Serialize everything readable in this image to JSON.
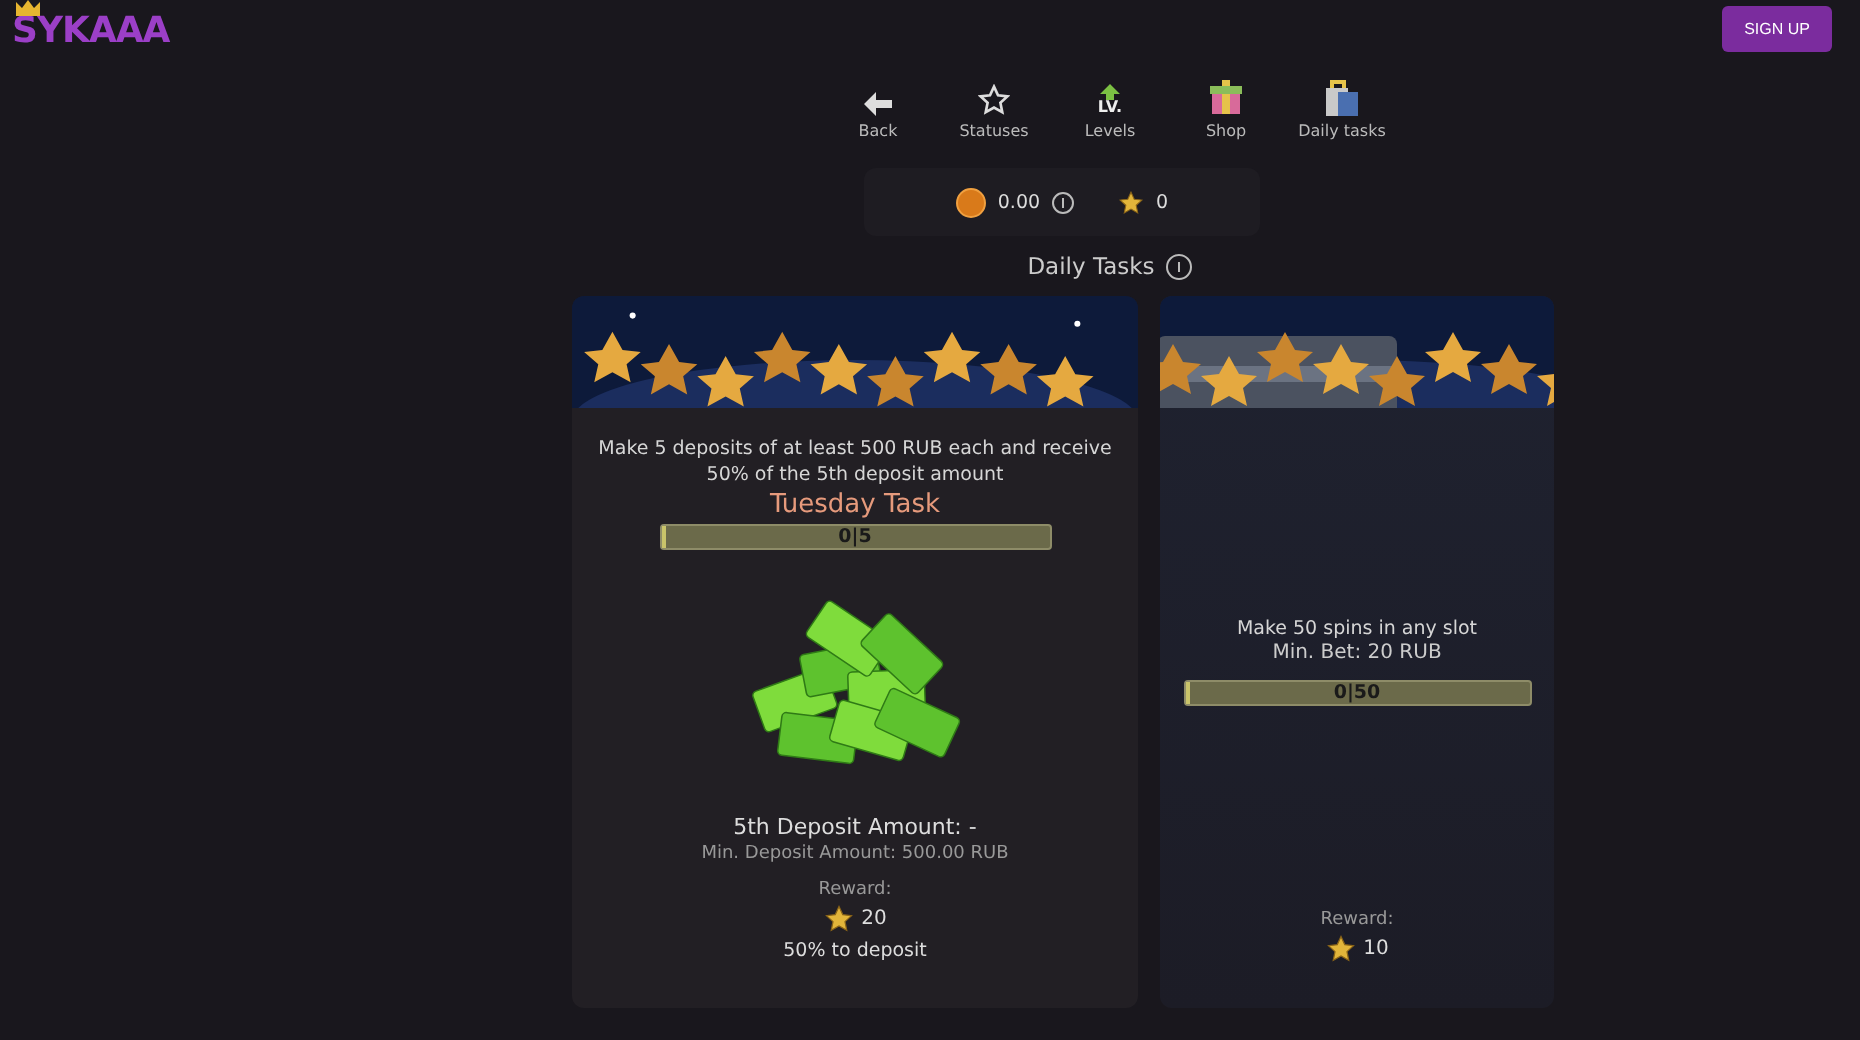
{
  "logo": "SYKAAA",
  "sign_up": "SIGN UP",
  "nav": [
    {
      "label": "Back",
      "kind": "back"
    },
    {
      "label": "Statuses",
      "kind": "star"
    },
    {
      "label": "Levels",
      "kind": "levels",
      "icon_text": "LV."
    },
    {
      "label": "Shop",
      "kind": "gift"
    },
    {
      "label": "Daily tasks",
      "kind": "bag"
    }
  ],
  "balance": {
    "coins": "0.00",
    "stars": "0"
  },
  "section_title": "Daily Tasks",
  "tasks": [
    {
      "kind": "deposit",
      "description": "Make 5 deposits of at least 500 RUB each and receive 50% of the 5th deposit amount",
      "subtitle": "Tuesday Task",
      "progress": {
        "text": "0|5",
        "level": 0
      },
      "amount": "5th Deposit Amount: -",
      "min": "Min. Deposit Amount: 500.00 RUB",
      "reward_label": "Reward:",
      "reward": "20",
      "reward_note": "50% to deposit"
    },
    {
      "kind": "spins",
      "description": "Make 50 spins in any slot",
      "min": "Min. Bet: 20 RUB",
      "progress": {
        "text": "0|50",
        "level": 0
      },
      "reward_label": "Reward:",
      "reward": "10"
    }
  ]
}
